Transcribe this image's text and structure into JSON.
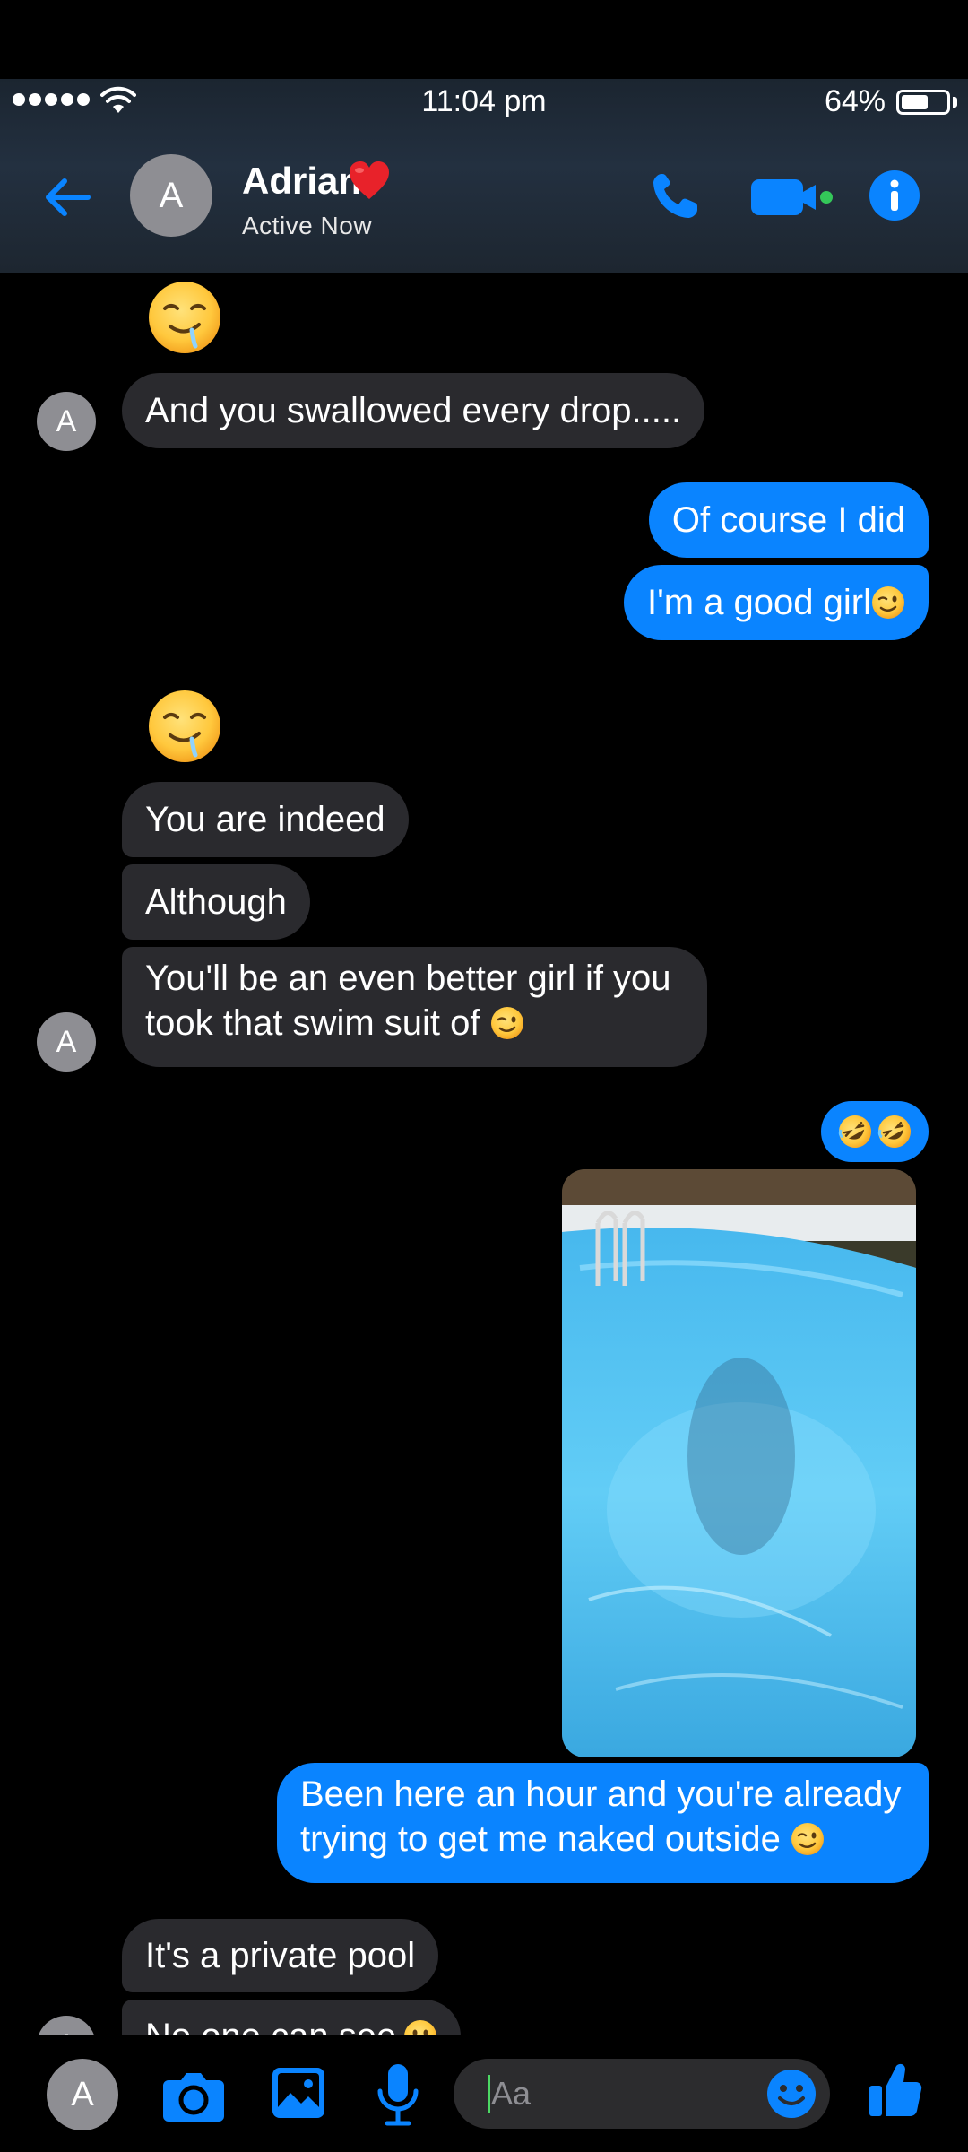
{
  "status_bar": {
    "time": "11:04 pm",
    "battery_percent": "64%",
    "battery_level": 0.64
  },
  "header": {
    "avatar_initial": "A",
    "contact_name": "Adrian",
    "contact_status": "Active Now"
  },
  "messages": [
    {
      "sender": "contact",
      "type": "emoji",
      "emoji": "drooling-face"
    },
    {
      "sender": "contact",
      "type": "text",
      "text": "And you swallowed every drop....."
    },
    {
      "sender": "me",
      "type": "text",
      "text": "Of course I did"
    },
    {
      "sender": "me",
      "type": "text",
      "text": "I'm a good girl",
      "emoji": "winking-face"
    },
    {
      "sender": "contact",
      "type": "emoji",
      "emoji": "drooling-face"
    },
    {
      "sender": "contact",
      "type": "text",
      "text": "You are indeed"
    },
    {
      "sender": "contact",
      "type": "text",
      "text": "Although"
    },
    {
      "sender": "contact",
      "type": "text",
      "line1": "You'll be an even better girl if you",
      "line2": "took that swim suit of",
      "emoji": "winking-face"
    },
    {
      "sender": "me",
      "type": "emoji-text",
      "emoji": "rolling-on-floor-laughing x2"
    },
    {
      "sender": "me",
      "type": "photo",
      "description": "pool photo"
    },
    {
      "sender": "me",
      "type": "text",
      "line1": "Been here an hour and you're already",
      "line2": "trying to get me naked outside",
      "emoji": "winking-face"
    },
    {
      "sender": "contact",
      "type": "text",
      "text": "It's a private pool"
    },
    {
      "sender": "contact",
      "type": "text",
      "text": "No one can see",
      "emoji": "grinning-face",
      "partially_visible": true
    }
  ],
  "composer": {
    "avatar_initial": "A",
    "placeholder": "Aa"
  },
  "colors": {
    "accent_blue": "#0a84ff",
    "incoming_bubble": "#2a2a2e",
    "online_green": "#34c759"
  }
}
